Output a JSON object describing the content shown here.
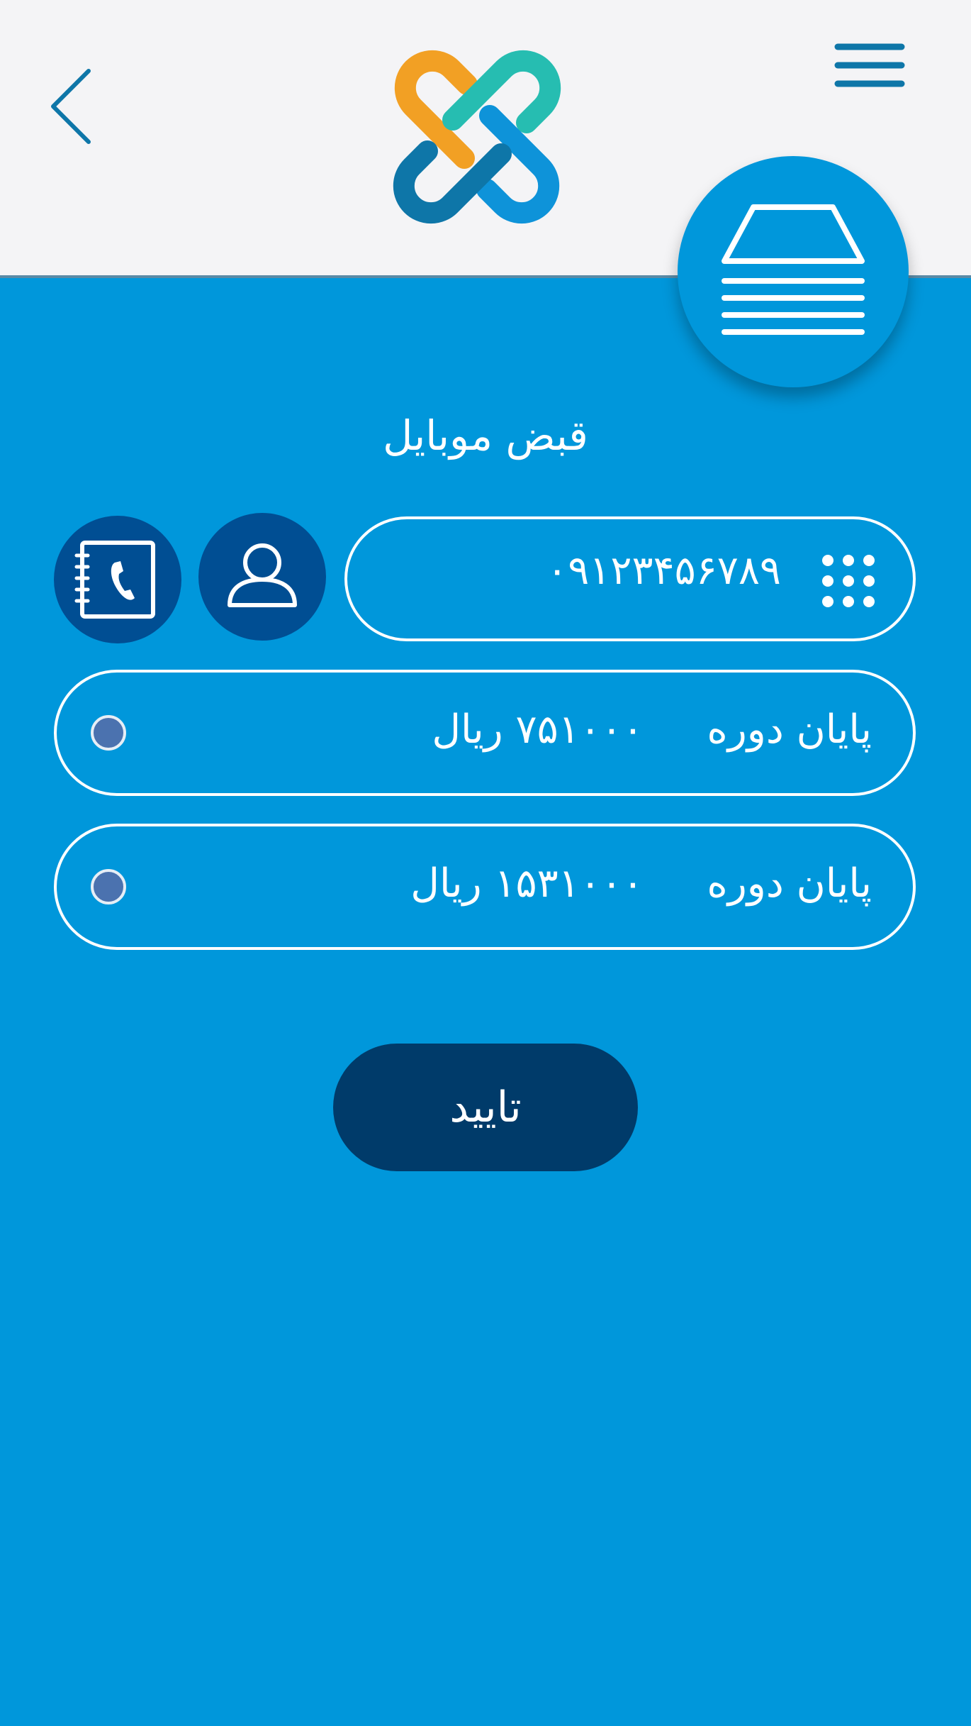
{
  "header": {
    "back_icon": "chevron-left-icon",
    "menu_icon": "hamburger-menu-icon",
    "logo_colors": [
      "#F2A024",
      "#26BDB1",
      "#0E93D9",
      "#0E76A8"
    ],
    "bill_icon": "bill-receipt-icon"
  },
  "main": {
    "title": "قبض موبایل",
    "phone": {
      "value": "۰۹۱۲۳۴۵۶۷۸۹",
      "keypad_icon": "keypad-icon"
    },
    "profile_icon": "user-icon",
    "contacts_icon": "phonebook-icon",
    "options": [
      {
        "label": "پایان دوره",
        "amount": "۷۵۱۰۰۰ ریال",
        "selected": false
      },
      {
        "label": "پایان دوره",
        "amount": "۱۵۳۱۰۰۰ ریال",
        "selected": false
      }
    ],
    "confirm_label": "تایید"
  },
  "colors": {
    "background": "#0097DB",
    "header": "#F4F4F6",
    "dark_button": "#004E93",
    "confirm_button": "#003B6A"
  }
}
